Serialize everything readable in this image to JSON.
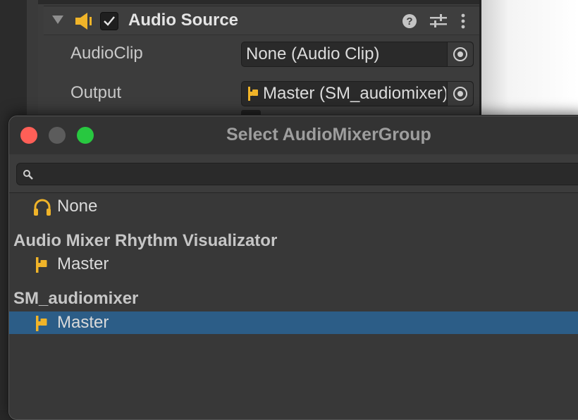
{
  "inspector": {
    "component": {
      "title": "Audio Source",
      "enabled": true,
      "icons": [
        "fold-arrow-icon",
        "speaker-icon",
        "checkbox",
        "help-icon",
        "preset-sliders-icon",
        "kebab-menu-icon"
      ]
    },
    "properties": [
      {
        "label": "AudioClip",
        "value": "None (Audio Clip)",
        "icon": "object-picker-icon"
      },
      {
        "label": "Output",
        "value": "Master (SM_audiomixer)",
        "icon": "mixer-group-icon"
      }
    ]
  },
  "dialog": {
    "title": "Select AudioMixerGroup",
    "search": {
      "value": "",
      "placeholder": ""
    },
    "none_item": {
      "label": "None",
      "icon": "headphones-icon"
    },
    "groups": [
      {
        "name": "Audio Mixer Rhythm Visualizator",
        "items": [
          {
            "label": "Master",
            "icon": "mixer-group-icon",
            "selected": false
          }
        ]
      },
      {
        "name": "SM_audiomixer",
        "items": [
          {
            "label": "Master",
            "icon": "mixer-group-icon",
            "selected": true
          }
        ]
      }
    ],
    "colors": {
      "selection": "#2c5d87",
      "icon_accent": "#f0b429",
      "close": "#ff5f57",
      "zoom": "#28c840"
    }
  }
}
